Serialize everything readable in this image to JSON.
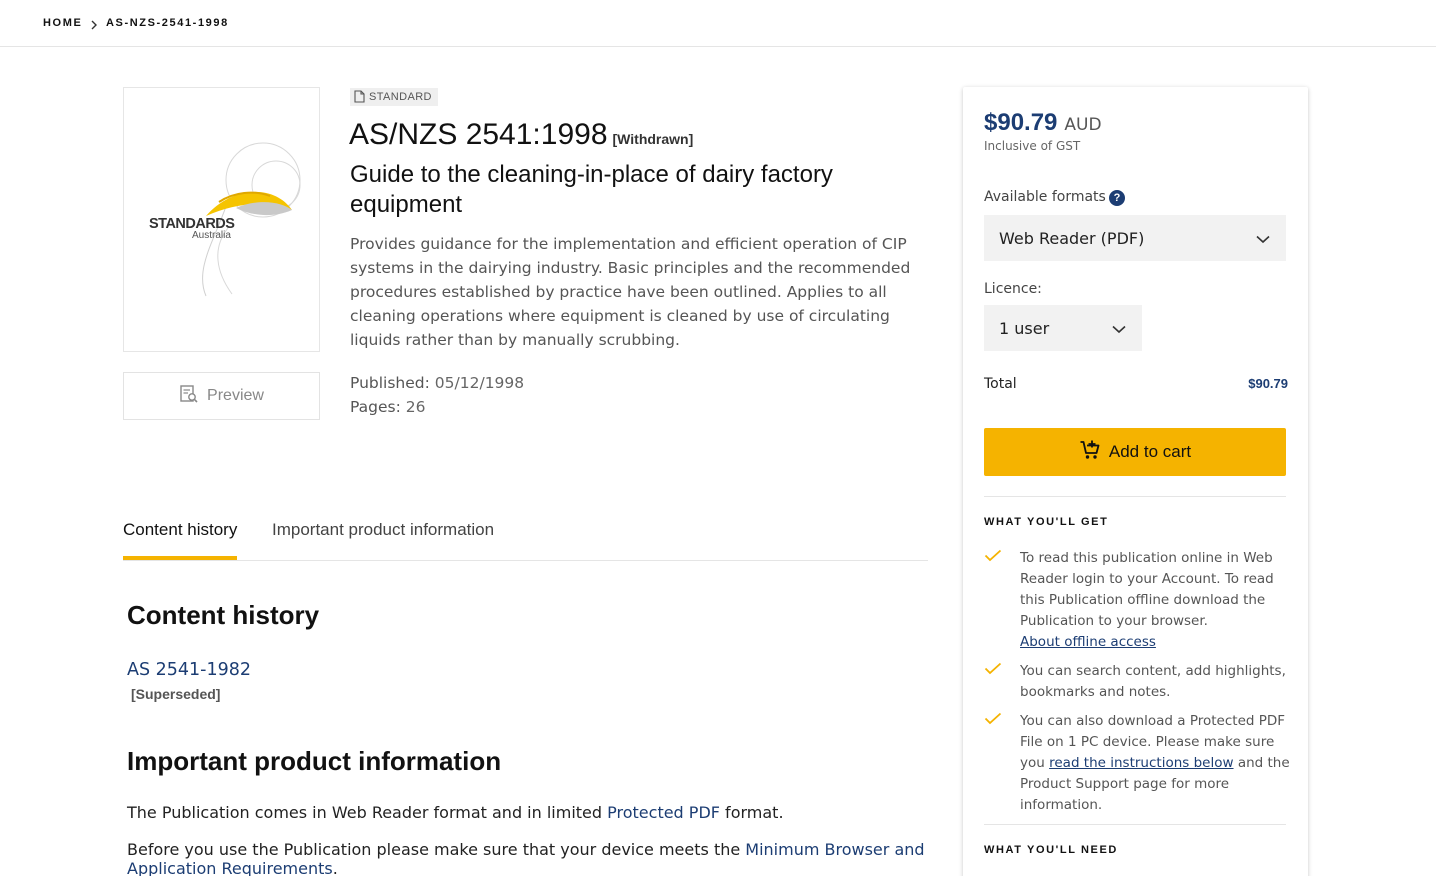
{
  "breadcrumb": {
    "home": "HOME",
    "current": "AS-NZS-2541-1998"
  },
  "cover": {
    "logo_text": "STANDARDS",
    "logo_sub": "Australia"
  },
  "preview": {
    "label": "Preview"
  },
  "product": {
    "type_badge": "STANDARD",
    "code": "AS/NZS 2541:1998",
    "status": "[Withdrawn]",
    "title": "Guide to the cleaning-in-place of dairy factory equipment",
    "description": "Provides guidance for the implementation and efficient operation of CIP systems in the dairying industry. Basic principles and the recommended procedures established by practice have been outlined. Applies to all cleaning operations where equipment is cleaned by use of circulating liquids rather than by manually scrubbing.",
    "published_label": "Published:",
    "published_value": "05/12/1998",
    "pages_label": "Pages:",
    "pages_value": "26"
  },
  "tabs": [
    {
      "label": "Content history"
    },
    {
      "label": "Important product information"
    }
  ],
  "content_history": {
    "heading": "Content history",
    "items": [
      {
        "code": "AS 2541-1982",
        "status": "[Superseded]"
      }
    ]
  },
  "important_info": {
    "heading": "Important product information",
    "p1_before": "The Publication comes in Web Reader format and in limited ",
    "p1_link": "Protected PDF",
    "p1_after": " format.",
    "p2_before": "Before you use the Publication please make sure that your device meets the ",
    "p2_link": "Minimum Browser and Application Requirements",
    "p2_after": "."
  },
  "sidebar": {
    "price": "$90.79",
    "currency": "AUD",
    "gst_note": "Inclusive of GST",
    "formats_label": "Available formats",
    "help_glyph": "?",
    "format_value": "Web Reader (PDF)",
    "licence_label": "Licence:",
    "licence_value": "1 user",
    "total_label": "Total",
    "total_value": "$90.79",
    "add_to_cart": "Add to cart",
    "what_you_get_heading": "WHAT YOU'LL GET",
    "benefit_1_text": "To read this publication online in Web Reader login to your Account. To read this Publication offline download the Publication to your browser.",
    "benefit_1_link": "About offline access",
    "benefit_2_text": "You can search content, add highlights, bookmarks and notes.",
    "benefit_3_before": "You can also download a Protected PDF File on 1 PC device. Please make sure you ",
    "benefit_3_link": "read the instructions below",
    "benefit_3_after": " and the Product Support page for more information.",
    "what_you_need_heading": "WHAT YOU'LL NEED"
  },
  "colors": {
    "brand_navy": "#1c3d73",
    "accent_yellow": "#f5b300",
    "logo_yellow": "#f5c400"
  },
  "icons": {
    "breadcrumb_separator": "chevron-right-icon",
    "badge": "document-icon",
    "preview": "preview-search-icon",
    "select": "chevron-down-icon",
    "cart": "cart-plus-icon",
    "benefit": "check-icon",
    "help": "question-icon"
  }
}
